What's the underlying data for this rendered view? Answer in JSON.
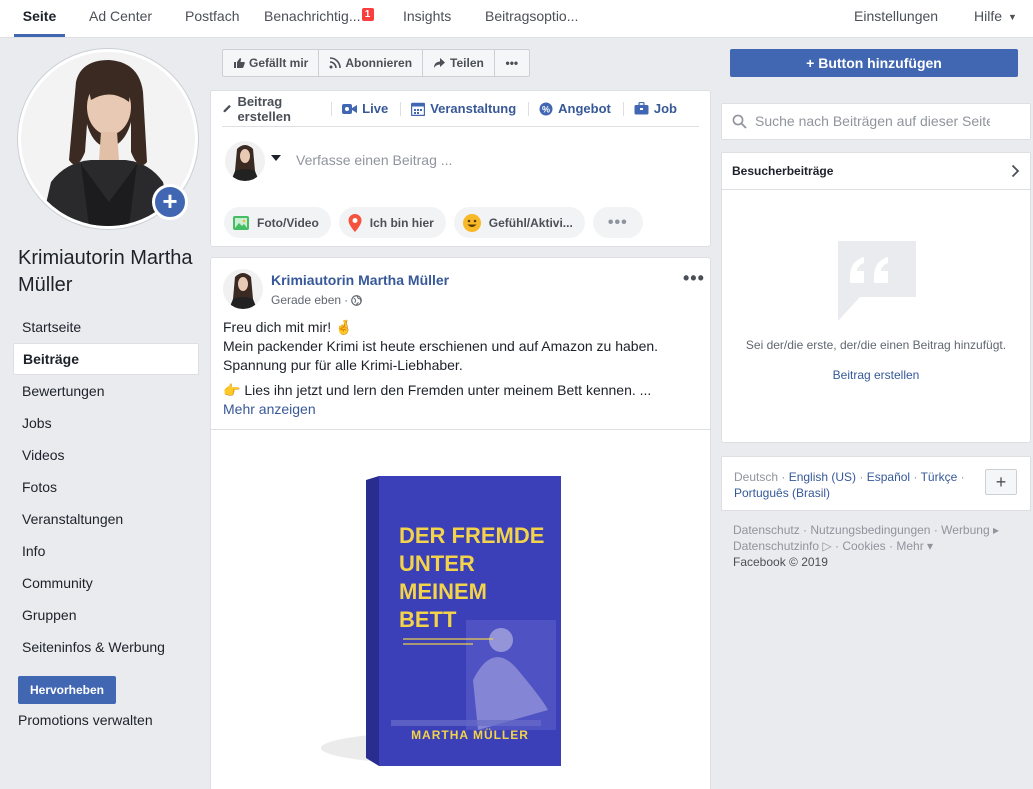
{
  "topnav": {
    "tabs": [
      {
        "label": "Seite"
      },
      {
        "label": "Ad Center"
      },
      {
        "label": "Postfach"
      },
      {
        "label": "Benachrichtig...",
        "badge": "1"
      },
      {
        "label": "Insights"
      },
      {
        "label": "Beitragsoptio..."
      }
    ],
    "settings": "Einstellungen",
    "help": "Hilfe"
  },
  "profile": {
    "name": "Krimiautorin Martha Müller"
  },
  "sidebar": {
    "items": [
      {
        "label": "Startseite"
      },
      {
        "label": "Beiträge"
      },
      {
        "label": "Bewertungen"
      },
      {
        "label": "Jobs"
      },
      {
        "label": "Videos"
      },
      {
        "label": "Fotos"
      },
      {
        "label": "Veranstaltungen"
      },
      {
        "label": "Info"
      },
      {
        "label": "Community"
      },
      {
        "label": "Gruppen"
      },
      {
        "label": "Seiteninfos & Werbung"
      }
    ],
    "promote_button": "Hervorheben",
    "promotions_link": "Promotions verwalten"
  },
  "actions": {
    "like": "Gefällt mir",
    "follow": "Abonnieren",
    "share": "Teilen",
    "add_button": "+ Button hinzufügen"
  },
  "composer": {
    "tabs": {
      "create": "Beitrag erstellen",
      "live": "Live",
      "event": "Veranstaltung",
      "offer": "Angebot",
      "job": "Job"
    },
    "placeholder": "Verfasse einen Beitrag ...",
    "pills": {
      "photo": "Foto/Video",
      "checkin": "Ich bin hier",
      "feeling": "Gefühl/Aktivi..."
    }
  },
  "post": {
    "author": "Krimiautorin Martha Müller",
    "time": "Gerade eben",
    "line1": "Freu dich mit mir! 🤞",
    "line2": "Mein packender Krimi ist heute erschienen und auf Amazon zu haben. Spannung pur für alle Krimi-Liebhaber.",
    "line3": "👉 Lies ihn jetzt und lern den Fremden unter meinem Bett kennen. ...",
    "more": "Mehr anzeigen",
    "book": {
      "title_lines": [
        "DER FREMDE",
        "UNTER",
        "MEINEM",
        "BETT"
      ],
      "author": "MARTHA MÜLLER",
      "cover_color": "#3b3fb8",
      "title_color": "#f2d34a"
    }
  },
  "search": {
    "placeholder": "Suche nach Beiträgen auf dieser Seite"
  },
  "visitor_posts": {
    "title": "Besucherbeiträge",
    "empty_text": "Sei der/die erste, der/die einen Beitrag hinzufügt.",
    "create_link": "Beitrag erstellen"
  },
  "languages": {
    "current": "Deutsch",
    "options": [
      "English (US)",
      "Español",
      "Türkçe",
      "Português (Brasil)"
    ]
  },
  "footer": {
    "links": [
      "Datenschutz",
      "Nutzungsbedingungen",
      "Werbung",
      "Datenschutzinfo",
      "Cookies",
      "Mehr"
    ],
    "copyright": "Facebook © 2019"
  },
  "colors": {
    "brand_blue": "#4267b2",
    "link_blue": "#365899",
    "page_bg": "#e9ebee"
  }
}
